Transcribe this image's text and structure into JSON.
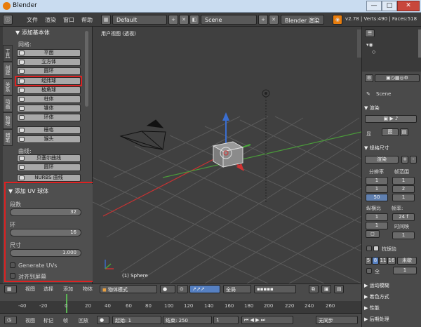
{
  "window": {
    "title": "Blender",
    "minimize": "—",
    "maximize": "□",
    "close": "✕"
  },
  "info_header": {
    "menus": [
      "文件",
      "渲染",
      "窗口",
      "帮助"
    ],
    "layout": "Default",
    "scene": "Scene",
    "engine": "Blender 渲染",
    "stats": "v2.78 | Verts:490 | Faces:518"
  },
  "tool_shelf": {
    "tabs": [
      "工具",
      "创建",
      "关系",
      "动画",
      "物理",
      "蜡笔"
    ],
    "section_title": "▼ 添加基本体",
    "mesh_label": "网格:",
    "mesh_tools": [
      "平面",
      "立方体",
      "圆环",
      "经纬球",
      "棱角球",
      "柱体",
      "锥体",
      "环体",
      "栅格",
      "猴头"
    ],
    "curve_label": "曲线:",
    "curve_tools": [
      "贝塞尔曲线",
      "圆环",
      "NURBS 曲线"
    ]
  },
  "operator": {
    "title": "▼ 添加 UV 球体",
    "segments_label": "段数",
    "segments_value": "32",
    "rings_label": "环",
    "rings_value": "16",
    "size_label": "尺寸",
    "size_value": "1.000",
    "generate_uvs": "Generate UVs",
    "align_view": "对齐到屏幕"
  },
  "viewport": {
    "label": "用户视图 (透视)",
    "selection": "(1) Sphere"
  },
  "viewport_header": {
    "menus": [
      "视图",
      "选择",
      "添加",
      "物体"
    ],
    "mode": "物体模式",
    "pivot": "全局"
  },
  "timeline": {
    "ticks": [
      "-40",
      "-20",
      "0",
      "20",
      "40",
      "60",
      "80",
      "100",
      "120",
      "140",
      "160",
      "180",
      "200",
      "220",
      "240",
      "260"
    ],
    "menus": [
      "视图",
      "标记",
      "帧",
      "回放"
    ],
    "start_label": "起始:",
    "start_value": "1",
    "end_label": "结束:",
    "end_value": "250",
    "sync": "无同步"
  },
  "properties": {
    "scene_label": "Scene",
    "render_head": "▼ 渲染",
    "display_label": "显",
    "display_value": "图",
    "dims_head": "▼ 规格尺寸",
    "preset": "渲染",
    "res_label": "分辨率",
    "fps_range": "帧范围",
    "res_x": "1",
    "res_y": "1",
    "res_pct": "50",
    "frame_a": "1",
    "frame_b": "2",
    "frame_c": "1",
    "aspect_label": "纵横比",
    "framerate_label": "帧率:",
    "fps": "24 f",
    "time_label": "时间映",
    "aa_head": "抗锯齿",
    "aa_a": "5",
    "aa_b": "8",
    "aa_c": "11",
    "aa_d": "16",
    "filter": "米歇",
    "full": "全",
    "full_val": "1",
    "sections": [
      "▶ 运动模糊",
      "▶ 着色方式",
      "▶ 性能",
      "▶ 后期处理"
    ]
  }
}
